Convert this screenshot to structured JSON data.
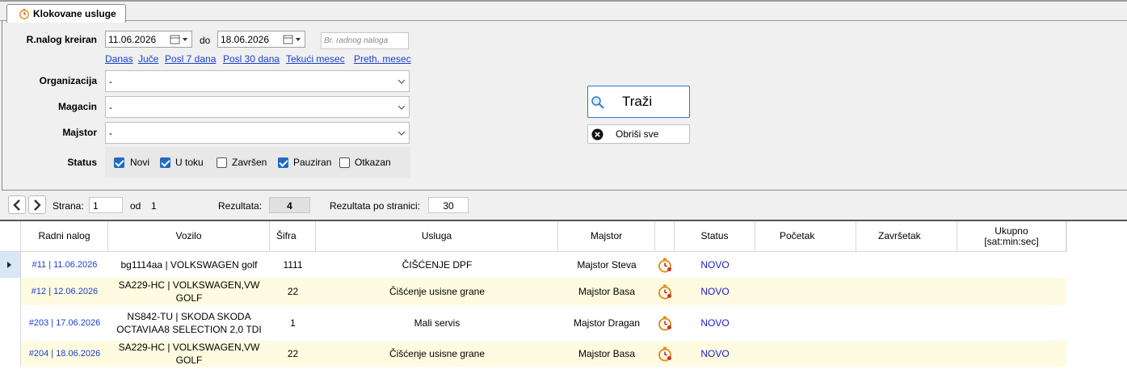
{
  "tab": {
    "label": "Klokovane usluge",
    "icon": "stopwatch-icon"
  },
  "filters": {
    "created_label": "R.nalog kreiran",
    "date_from": "11.06.2026",
    "date_to": "18.06.2026",
    "to_label": "do",
    "order_placeholder": "Br. radnog naloga",
    "quick": [
      "Danas",
      "Juče",
      "Posl 7 dana",
      "Posl 30 dana",
      "Tekući mesec",
      "Preth. mesec"
    ],
    "org_label": "Organizacija",
    "org_value": "-",
    "store_label": "Magacin",
    "store_value": "-",
    "mech_label": "Majstor",
    "mech_value": "-",
    "status_label": "Status",
    "statuses": [
      {
        "label": "Novi",
        "checked": true
      },
      {
        "label": "U toku",
        "checked": true
      },
      {
        "label": "Završen",
        "checked": false
      },
      {
        "label": "Pauziran",
        "checked": true
      },
      {
        "label": "Otkazan",
        "checked": false
      }
    ]
  },
  "actions": {
    "search": "Traži",
    "clear": "Obriši sve"
  },
  "pager": {
    "page_label": "Strana:",
    "page": "1",
    "of_label": "od",
    "total_pages": "1",
    "results_label": "Rezultata:",
    "results": "4",
    "per_page_label": "Rezultata po stranici:",
    "per_page": "30"
  },
  "grid": {
    "headers": [
      "Radni nalog",
      "Vozilo",
      "Šifra",
      "Usluga",
      "Majstor",
      "",
      "Status",
      "Početak",
      "Završetak",
      "Ukupno\n[sat:min:sec]"
    ],
    "rows": [
      {
        "nalog": "#11  |  11.06.2026",
        "vozilo": "bg1114aa | VOLKSWAGEN golf",
        "sifra": "1111",
        "usluga": "ČIŠĆENJE DPF",
        "majstor": "Majstor Steva",
        "status": "NOVO",
        "pocetak": "",
        "zavrsetak": "",
        "ukupno": ""
      },
      {
        "nalog": "#12  |  12.06.2026",
        "vozilo": "SA229-HC | VOLKSWAGEN,VW GOLF",
        "sifra": "22",
        "usluga": "Čišćenje usisne grane",
        "majstor": "Majstor Basa",
        "status": "NOVO",
        "pocetak": "",
        "zavrsetak": "",
        "ukupno": ""
      },
      {
        "nalog": "#203  |  17.06.2026",
        "vozilo": "NS842-TU | SKODA SKODA OCTAVIAA8 SELECTION 2,0 TDI",
        "sifra": "1",
        "usluga": "Mali servis",
        "majstor": "Majstor Dragan",
        "status": "NOVO",
        "pocetak": "",
        "zavrsetak": "",
        "ukupno": ""
      },
      {
        "nalog": "#204  |  18.06.2026",
        "vozilo": "SA229-HC | VOLKSWAGEN,VW GOLF",
        "sifra": "22",
        "usluga": "Čišćenje usisne grane",
        "majstor": "Majstor Basa",
        "status": "NOVO",
        "pocetak": "",
        "zavrsetak": "",
        "ukupno": ""
      }
    ]
  },
  "colors": {
    "link": "#1a3fd0",
    "accent": "#1f6bc2",
    "alt_row": "#fffbe0"
  }
}
